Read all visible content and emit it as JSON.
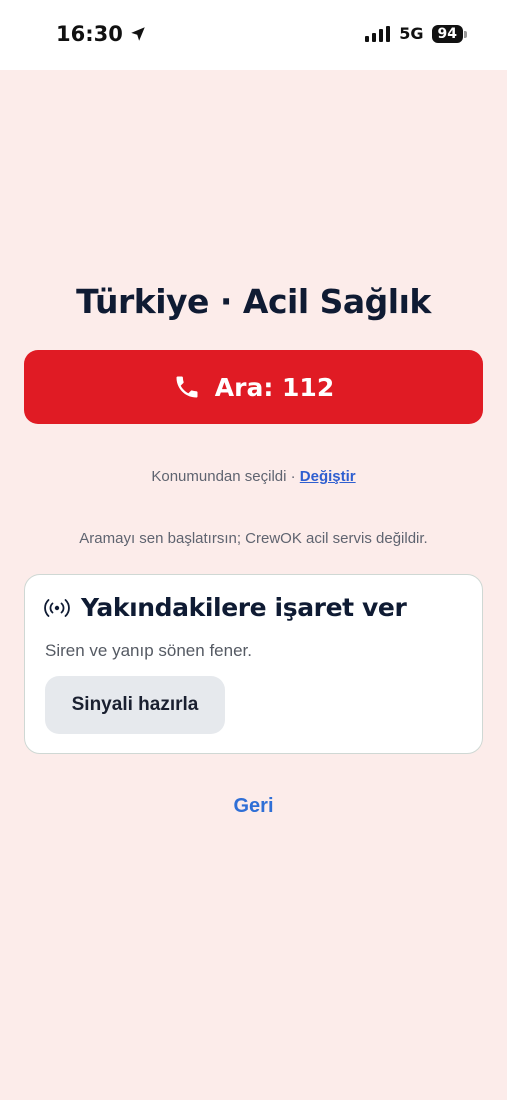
{
  "status_bar": {
    "time": "16:30",
    "network": "5G",
    "battery": "94"
  },
  "page": {
    "title": "Türkiye · Acil Sağlık"
  },
  "call_button": {
    "label": "Ara: 112"
  },
  "location": {
    "text": "Konumundan seçildi · ",
    "change_label": "Değiştir"
  },
  "disclaimer": "Aramayı sen başlatırsın; CrewOK acil servis değildir.",
  "signal_card": {
    "title": "Yakındakilere işaret ver",
    "subtitle": "Siren ve yanıp sönen fener.",
    "button_label": "Sinyali hazırla"
  },
  "back_label": "Geri",
  "colors": {
    "background": "#fcecea",
    "call_red": "#e01b24",
    "title_navy": "#0f1b33",
    "link_blue": "#2f6fd6"
  }
}
